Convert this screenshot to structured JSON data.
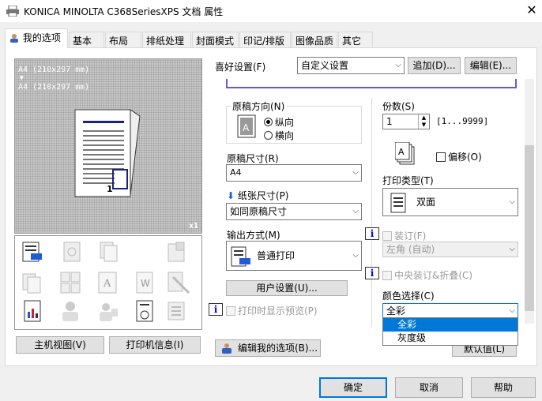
{
  "window": {
    "title": "KONICA MINOLTA C368SeriesXPS 文档 属性"
  },
  "tabs": [
    {
      "label": "我的选项"
    },
    {
      "label": "基本"
    },
    {
      "label": "布局"
    },
    {
      "label": "排纸处理"
    },
    {
      "label": "封面模式"
    },
    {
      "label": "印记/排版"
    },
    {
      "label": "图像品质"
    },
    {
      "label": "其它"
    }
  ],
  "preview": {
    "line1": "A4 (210x297 mm)",
    "arrow": "▼",
    "line2": "A4 (210x297 mm)",
    "zoom": "x1"
  },
  "left_buttons": {
    "host_view": "主机视图(V)",
    "printer_info": "打印机信息(I)"
  },
  "favorites": {
    "label": "喜好设置(F)",
    "value": "自定义设置",
    "add": "追加(D)...",
    "edit": "编辑(E)..."
  },
  "orientation": {
    "label": "原稿方向(N)",
    "portrait": "纵向",
    "landscape": "横向",
    "selected": "portrait"
  },
  "original_size": {
    "label": "原稿尺寸(R)",
    "value": "A4"
  },
  "paper_size": {
    "label": "纸张尺寸(P)",
    "value": "如同原稿尺寸"
  },
  "output": {
    "label": "输出方式(M)",
    "value": "普通打印"
  },
  "user_settings": "用户设置(U)...",
  "show_preview": "打印时显示预览(P)",
  "copies": {
    "label": "份数(S)",
    "value": "1",
    "range": "[1...9999]"
  },
  "offset": "偏移(O)",
  "print_type": {
    "label": "打印类型(T)",
    "value": "双面"
  },
  "staple": {
    "label": "装订(F)",
    "value": "左角 (自动)"
  },
  "center_staple": "中央装订&折叠(C)",
  "color": {
    "label": "颜色选择(C)",
    "value": "全彩",
    "options": [
      "全彩",
      "灰度级"
    ],
    "selected_index": 0
  },
  "defaults": "默认值(L)",
  "edit_my_options": "编辑我的选项(B)...",
  "footer": {
    "ok": "确定",
    "cancel": "取消",
    "help": "帮助"
  }
}
